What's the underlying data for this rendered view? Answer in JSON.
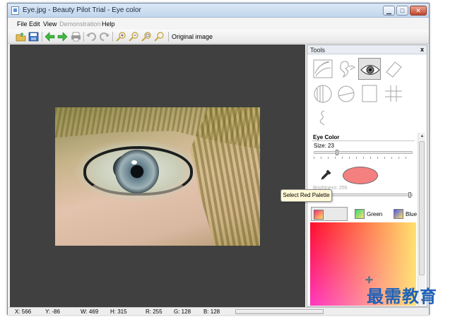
{
  "window": {
    "title": "Eye.jpg - Beauty Pilot Trial - Eye color",
    "controls": [
      "minimize",
      "maximize",
      "close"
    ]
  },
  "menu": {
    "items": [
      {
        "label": "File",
        "enabled": true
      },
      {
        "label": "Edit",
        "enabled": true
      },
      {
        "label": "View",
        "enabled": true
      },
      {
        "label": "Demonstration",
        "enabled": false
      },
      {
        "label": "Help",
        "enabled": true
      }
    ]
  },
  "toolbar": {
    "buttons": [
      {
        "icon": "open-folder-icon",
        "color": "#d8b04c"
      },
      {
        "icon": "save-icon",
        "color": "#3d74c4"
      },
      {
        "icon": "back-arrow-icon",
        "color": "#3fb83f"
      },
      {
        "icon": "forward-arrow-icon",
        "color": "#3fb83f"
      },
      {
        "icon": "print-icon",
        "color": "#8c8c8c"
      },
      {
        "icon": "undo-icon",
        "color": "#a9a9a9"
      },
      {
        "icon": "redo-icon",
        "color": "#a9a9a9"
      },
      {
        "icon": "zoom-in-icon",
        "color": "#c9a94a"
      },
      {
        "icon": "zoom-out-icon",
        "color": "#c9a94a"
      },
      {
        "icon": "zoom-fit-icon",
        "color": "#c9a94a"
      },
      {
        "icon": "zoom-actual-icon",
        "color": "#c9a94a"
      }
    ],
    "original_image_label": "Original image"
  },
  "tools_panel": {
    "title": "Tools",
    "close_label": "x",
    "tools": [
      {
        "icon": "texture-tool-icon",
        "selected": false
      },
      {
        "icon": "cherub-tool-icon",
        "selected": false
      },
      {
        "icon": "eye-tool-icon",
        "selected": true
      },
      {
        "icon": "eraser-tool-icon",
        "selected": false
      },
      {
        "icon": "contrast-tool-icon",
        "selected": false
      },
      {
        "icon": "circle-line-tool-icon",
        "selected": false
      },
      {
        "icon": "frame-tool-icon",
        "selected": false
      },
      {
        "icon": "grid-tool-icon",
        "selected": false
      },
      {
        "icon": "squiggle-tool-icon",
        "selected": false
      }
    ],
    "section_title": "Eye Color",
    "size_label": "Size: 23",
    "size_level": 0.23,
    "selected_color": "#f58080",
    "brightness_label": "Brightness: 255",
    "brightness_level": 1.0,
    "palettes": [
      {
        "label": "",
        "swatch": "#ff2d6a",
        "selected": true
      },
      {
        "label": "Green",
        "swatch": "#2ed879",
        "selected": false
      },
      {
        "label": "Blue",
        "swatch": "#4a56e8",
        "selected": false
      }
    ],
    "tooltip": "Select Red Palette"
  },
  "status": {
    "x": "X: 566",
    "y": "Y: -86",
    "w": "W: 469",
    "h": "H: 315",
    "r": "R: 255",
    "g": "G: 128",
    "b": "B: 128"
  },
  "watermark": "最需教育",
  "colors": {
    "canvas_background": "#404040",
    "titlebar": "#c2d6ec"
  }
}
